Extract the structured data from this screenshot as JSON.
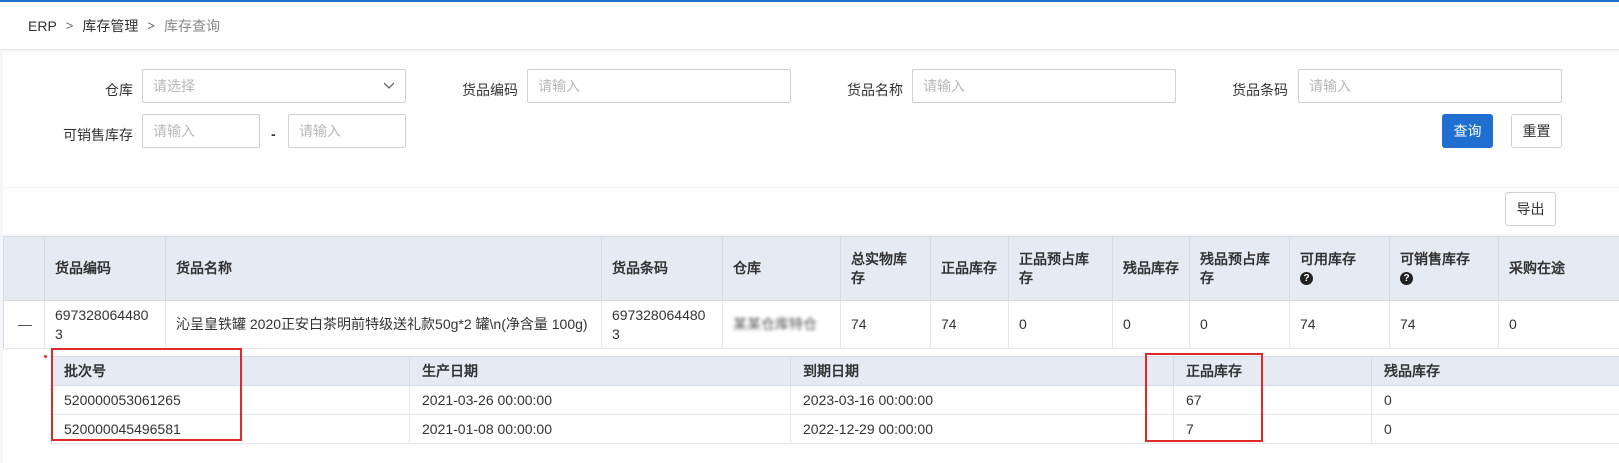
{
  "breadcrumb": {
    "items": [
      "ERP",
      "库存管理",
      "库存查询"
    ],
    "sep": ">"
  },
  "filters": {
    "warehouse": {
      "label": "仓库",
      "placeholder": "请选择"
    },
    "goods_code": {
      "label": "货品编码",
      "placeholder": "请输入"
    },
    "goods_name": {
      "label": "货品名称",
      "placeholder": "请输入"
    },
    "goods_barcode": {
      "label": "货品条码",
      "placeholder": "请输入"
    },
    "sellable": {
      "label": "可销售库存",
      "min_placeholder": "请输入",
      "max_placeholder": "请输入",
      "dash": "-"
    }
  },
  "buttons": {
    "query": "查询",
    "reset": "重置",
    "export": "导出"
  },
  "table": {
    "headers": {
      "code": "货品编码",
      "name": "货品名称",
      "barcode": "货品条码",
      "warehouse": "仓库",
      "total": "总实物库存",
      "good": "正品库存",
      "good_reserved": "正品预占库存",
      "defect": "残品库存",
      "defect_reserved": "残品预占库存",
      "available": "可用库存",
      "sellable": "可销售库存",
      "purchasing": "采购在途"
    },
    "help_icon": "?",
    "row": {
      "code": "6973280644803",
      "name": "沁呈皇铁罐 2020正安白茶明前特级送礼款50g*2 罐\\n(净含量 100g)",
      "barcode": "6973280644803",
      "warehouse": "某某仓库特仓",
      "total": "74",
      "good": "74",
      "good_reserved": "0",
      "defect": "0",
      "defect_reserved": "0",
      "available": "74",
      "sellable": "74",
      "purchasing": "0"
    }
  },
  "subtable": {
    "headers": {
      "batch": "批次号",
      "prod_date": "生产日期",
      "exp_date": "到期日期",
      "good": "正品库存",
      "defect": "残品库存"
    },
    "rows": [
      {
        "batch": "520000053061265",
        "prod_date": "2021-03-26 00:00:00",
        "exp_date": "2023-03-16 00:00:00",
        "good": "67",
        "defect": "0"
      },
      {
        "batch": "520000045496581",
        "prod_date": "2021-01-08 00:00:00",
        "exp_date": "2022-12-29 00:00:00",
        "good": "7",
        "defect": "0"
      }
    ]
  },
  "colors": {
    "primary": "#1f6fd1",
    "highlight": "#e02a2a",
    "header_bg": "#e6ebf3"
  }
}
